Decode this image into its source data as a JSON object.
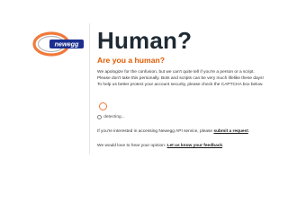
{
  "brand": {
    "name": "newegg",
    "colors": {
      "orange": "#f07a3c",
      "blue": "#1c2f8f"
    }
  },
  "header": {
    "title": "Human?",
    "subtitle": "Are you a human?"
  },
  "messages": {
    "line1": "We apologize for the confusion, but we can't quite tell if you're a person or a script.",
    "line2": "Please don't take this personally. Bots and scripts can be very much lifelike these days!",
    "line3": "To help us better protect your account security, please check the CAPTCHA box below."
  },
  "captcha": {
    "status": "detecting..."
  },
  "api": {
    "prefix": "If you're interested in accessing Newegg API service, please ",
    "link": "submit a request",
    "suffix": "."
  },
  "feedback": {
    "prefix": "We would love to hear your opinion: ",
    "link": "Let us know your feedback",
    "suffix": "."
  }
}
